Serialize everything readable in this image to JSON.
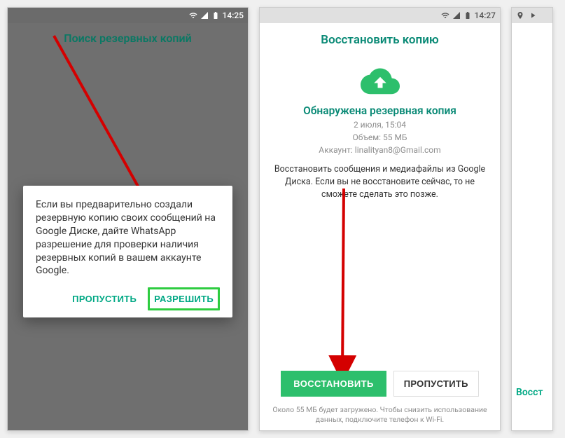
{
  "screen1": {
    "status": {
      "time": "14:25"
    },
    "title": "Поиск резервных копий",
    "dialog": {
      "message": "Если вы предварительно создали резервную копию своих сообщений на Google Диске, дайте WhatsApp разрешение для проверки наличия резервных копий в вашем аккаунте Google.",
      "skip_label": "ПРОПУСТИТЬ",
      "allow_label": "РАЗРЕШИТЬ"
    }
  },
  "screen2": {
    "status": {
      "time": "14:27"
    },
    "title": "Восстановить копию",
    "found_title": "Обнаружена резервная копия",
    "meta": {
      "date": "2 июля, 15:04",
      "size": "Объем: 55 МБ",
      "account": "Аккаунт: linalityan8@Gmail.com"
    },
    "description": "Восстановить сообщения и медиафайлы из Google Диска. Если вы не восстановите сейчас, то не сможете сделать это позже.",
    "restore_label": "ВОССТАНОВИТЬ",
    "skip_label": "ПРОПУСТИТЬ",
    "footnote": "Около 55 МБ будет загружено. Чтобы снизить использование данных, подключите телефон к Wi-Fi."
  },
  "screen3": {
    "fragment": "Восст"
  },
  "colors": {
    "accent": "#0a8a76",
    "button_green": "#2dbf6c",
    "highlight": "#2ecc40"
  }
}
